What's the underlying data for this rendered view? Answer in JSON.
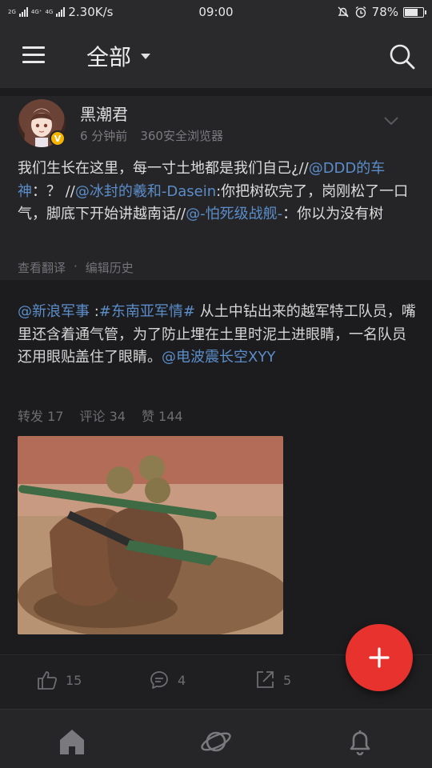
{
  "status_bar": {
    "network_speed": "2.30K/s",
    "time": "09:00",
    "battery": "78%",
    "battery_level": 0.78,
    "net_label_1": "2G",
    "net_label_2": "4G⁺",
    "net_label_3": "4G",
    "icons": [
      "signal-icon",
      "silent-icon",
      "alarm-icon",
      "battery-icon"
    ]
  },
  "app_bar": {
    "title": "全部",
    "icons": [
      "menu-icon",
      "dropdown-caret-icon",
      "search-icon"
    ]
  },
  "post": {
    "author": "黑潮君",
    "verified_badge": "V",
    "time_ago": "6 分钟前",
    "source": "360安全浏览器",
    "text_segments": [
      "我们生长在这里，每一寸土地都是我们自己¿//",
      "@DDD的车神",
      "：？ //",
      "@冰封的羲和-Dasein",
      ":你把树砍完了，岗刚松了一口气，脚底下开始讲越南话//",
      "@-怕死级战舰-",
      "：你以为没有树"
    ],
    "translate_label": "查看翻译",
    "separator": "·",
    "edit_history_label": "编辑历史"
  },
  "repost": {
    "text_segments": [
      "@新浪军事",
      " :",
      "#东南亚军情#",
      " 从土中钻出来的越军特工队员，嘴里还含着通气管，为了防止埋在土里时泥土进眼睛，一名队员还用眼贴盖住了眼睛。",
      "@电波震长空XYY"
    ],
    "stats": {
      "repost_label": "转发",
      "repost_count": "17",
      "comment_label": "评论",
      "comment_count": "34",
      "like_label": "赞",
      "like_count": "144"
    }
  },
  "actions": {
    "like_count": "15",
    "comment_count": "4",
    "share_count": "5"
  },
  "bottom_nav": [
    "home-icon",
    "discover-planet-icon",
    "notification-bell-icon"
  ],
  "fab": {
    "icon": "plus-icon"
  },
  "colors": {
    "background": "#1c1c1e",
    "mention": "#5b8dc9",
    "fab": "#e8322e",
    "badge": "#f4b400"
  }
}
